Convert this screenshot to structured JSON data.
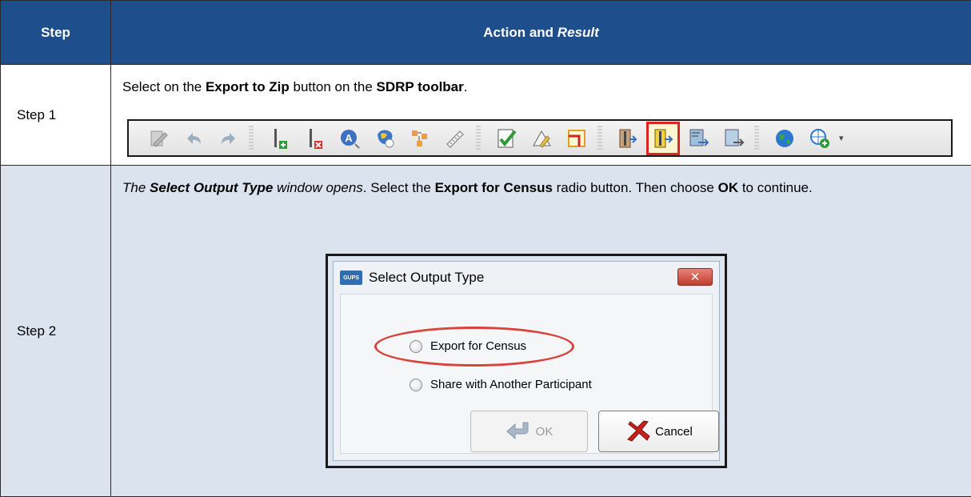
{
  "table": {
    "header": {
      "step": "Step",
      "action_prefix": "Action and ",
      "action_italic": "Result"
    },
    "rows": [
      {
        "step_label": "Step 1",
        "text": {
          "t1": "Select on the ",
          "b1": "Export to Zip",
          "t2": " button on the ",
          "b2": "SDRP toolbar",
          "t3": "."
        },
        "toolbar": {
          "icons": [
            "edit-pencil-icon",
            "undo-icon",
            "redo-icon",
            "add-point-icon",
            "delete-point-icon",
            "label-icon",
            "identify-icon",
            "topology-icon",
            "ruler-icon",
            "validate-icon",
            "edit-shape-icon",
            "split-icon",
            "import-zip-icon",
            "export-zip-icon",
            "export-map-icon",
            "share-icon",
            "globe-icon",
            "add-web-service-icon"
          ],
          "highlighted": "export-zip-icon",
          "highlight_color": "#e02424"
        }
      },
      {
        "step_label": "Step 2",
        "text": {
          "i1": "The ",
          "bi1": "Select Output Type",
          "i2": " window opens",
          "t1": ". Select the ",
          "b1": "Export for Census",
          "t2": " radio button. Then choose ",
          "b2": "OK",
          "t3": " to continue."
        },
        "dialog": {
          "logo_text": "GUPS",
          "title": "Select Output Type",
          "close_glyph": "✕",
          "options": [
            "Export for Census",
            "Share with Another Participant"
          ],
          "highlighted_option": "Export for Census",
          "ok_label": "OK",
          "cancel_label": "Cancel"
        }
      }
    ]
  },
  "colors": {
    "header_bg": "#1f4e8c",
    "row2_bg": "#dbe3ef",
    "highlight": "#d8443a"
  }
}
